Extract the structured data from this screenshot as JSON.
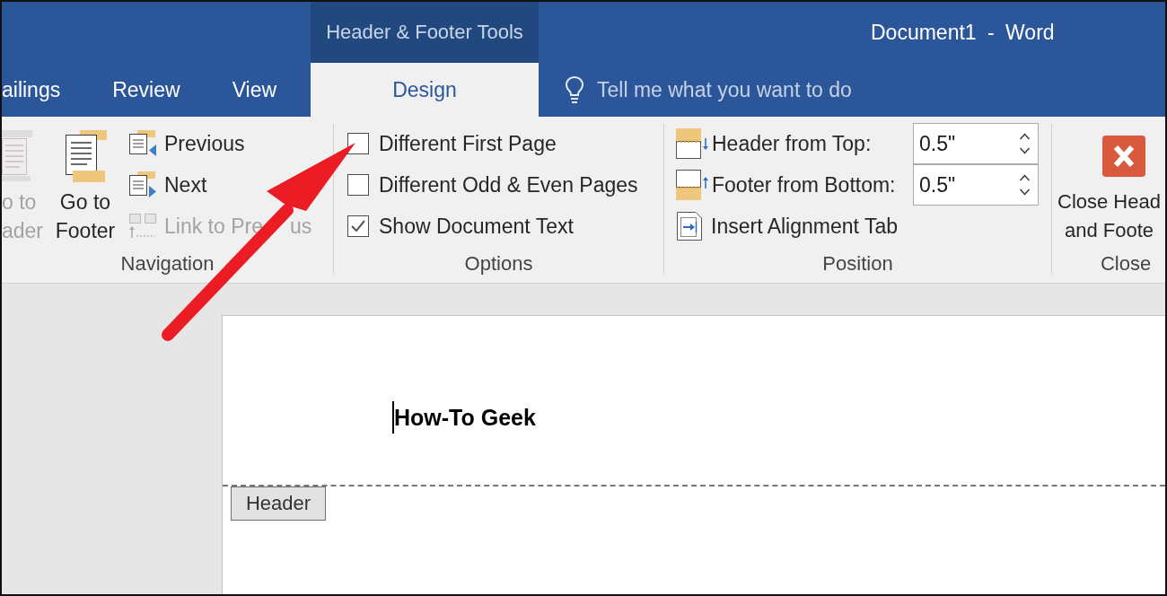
{
  "window": {
    "title": "Document1 - Word"
  },
  "tabs": [
    {
      "label": "ailings",
      "selected": false
    },
    {
      "label": "Review",
      "selected": false
    },
    {
      "label": "View",
      "selected": false
    }
  ],
  "contextual_tabs": {
    "group_label": "Header & Footer Tools",
    "tabs": [
      {
        "label": "Design",
        "selected": true
      }
    ]
  },
  "tell_me": {
    "placeholder": "Tell me what you want to do"
  },
  "ribbon": {
    "navigation": {
      "label": "Navigation",
      "go_to_header": {
        "lines": [
          "o to",
          "ader"
        ],
        "disabled": true
      },
      "go_to_footer": {
        "lines": [
          "Go to",
          "Footer"
        ],
        "disabled": false
      },
      "buttons": [
        {
          "label": "Previous",
          "disabled": false
        },
        {
          "label": "Next",
          "disabled": false
        },
        {
          "label": "Link to Pre",
          "label_tail": "us",
          "disabled": true
        }
      ]
    },
    "options": {
      "label": "Options",
      "checkboxes": [
        {
          "label": "Different First Page",
          "checked": false
        },
        {
          "label": "Different Odd & Even Pages",
          "checked": false
        },
        {
          "label": "Show Document Text",
          "checked": true
        }
      ]
    },
    "position": {
      "label": "Position",
      "spinners": [
        {
          "label": "Header from Top:",
          "value": "0.5\""
        },
        {
          "label": "Footer from Bottom:",
          "value": "0.5\""
        }
      ],
      "alignment_button": {
        "label": "Insert Alignment Tab"
      }
    },
    "close": {
      "label": "Close",
      "button": {
        "lines": [
          "Close Head",
          "and Foote"
        ]
      }
    }
  },
  "document": {
    "header_text": "How-To Geek",
    "header_tag": "Header"
  }
}
